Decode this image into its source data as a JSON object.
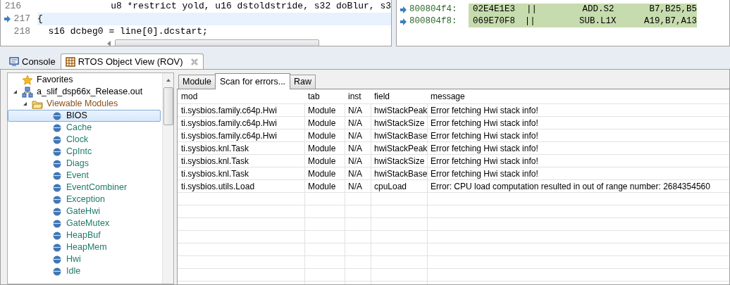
{
  "editor": {
    "lines": [
      {
        "number": "216",
        "code": "               u8 *restrict yold, u16 dstoldstride, s32 doBlur, s3",
        "current": false
      },
      {
        "number": "217",
        "code": "{",
        "current": true
      },
      {
        "number": "218",
        "code": "  s16 dcbeg0 = line[0].dcstart;",
        "current": false
      }
    ]
  },
  "disassembly": {
    "rows": [
      {
        "address": "800804f4:",
        "opcode": "02E4E1E3",
        "parallel": "||",
        "instruction": "ADD.S2",
        "operands": "B7,B25,B5",
        "current": true
      },
      {
        "address": "800804f8:",
        "opcode": "069E70F8",
        "parallel": "||",
        "instruction": "SUB.L1X",
        "operands": "A19,B7,A13",
        "current": true
      }
    ]
  },
  "view_tabs": [
    {
      "label": "Console",
      "kind": "console",
      "selected": false
    },
    {
      "label": "RTOS Object View (ROV)",
      "kind": "rov",
      "selected": true
    }
  ],
  "tree": [
    {
      "label": "Favorites",
      "kind": "favorites"
    },
    {
      "label": "a_slif_dsp66x_Release.out",
      "kind": "program",
      "expanded": true,
      "children": [
        {
          "label": "Viewable Modules",
          "kind": "folder",
          "expanded": true,
          "children": [
            {
              "label": "BIOS",
              "kind": "module",
              "selected": true
            },
            {
              "label": "Cache",
              "kind": "module",
              "selected": false
            },
            {
              "label": "Clock",
              "kind": "module",
              "selected": false
            },
            {
              "label": "CpIntc",
              "kind": "module",
              "selected": false
            },
            {
              "label": "Diags",
              "kind": "module",
              "selected": false
            },
            {
              "label": "Event",
              "kind": "module",
              "selected": false
            },
            {
              "label": "EventCombiner",
              "kind": "module",
              "selected": false
            },
            {
              "label": "Exception",
              "kind": "module",
              "selected": false
            },
            {
              "label": "GateHwi",
              "kind": "module",
              "selected": false
            },
            {
              "label": "GateMutex",
              "kind": "module",
              "selected": false
            },
            {
              "label": "HeapBuf",
              "kind": "module",
              "selected": false
            },
            {
              "label": "HeapMem",
              "kind": "module",
              "selected": false
            },
            {
              "label": "Hwi",
              "kind": "module",
              "selected": false
            },
            {
              "label": "Idle",
              "kind": "module",
              "selected": false
            }
          ]
        }
      ]
    }
  ],
  "detail_tabs": [
    {
      "label": "Module",
      "selected": false
    },
    {
      "label": "Scan for errors...",
      "selected": true
    },
    {
      "label": "Raw",
      "selected": false
    }
  ],
  "table": {
    "columns": [
      "mod",
      "tab",
      "inst",
      "field",
      "message"
    ],
    "rows": [
      [
        "ti.sysbios.family.c64p.Hwi",
        "Module",
        "N/A",
        "hwiStackPeak",
        "Error fetching Hwi stack info!"
      ],
      [
        "ti.sysbios.family.c64p.Hwi",
        "Module",
        "N/A",
        "hwiStackSize",
        "Error fetching Hwi stack info!"
      ],
      [
        "ti.sysbios.family.c64p.Hwi",
        "Module",
        "N/A",
        "hwiStackBase",
        "Error fetching Hwi stack info!"
      ],
      [
        "ti.sysbios.knl.Task",
        "Module",
        "N/A",
        "hwiStackPeak",
        "Error fetching Hwi stack info!"
      ],
      [
        "ti.sysbios.knl.Task",
        "Module",
        "N/A",
        "hwiStackSize",
        "Error fetching Hwi stack info!"
      ],
      [
        "ti.sysbios.knl.Task",
        "Module",
        "N/A",
        "hwiStackBase",
        "Error fetching Hwi stack info!"
      ],
      [
        "ti.sysbios.utils.Load",
        "Module",
        "N/A",
        "cpuLoad",
        "Error: CPU load computation resulted in out of range number: 2684354560"
      ]
    ]
  }
}
